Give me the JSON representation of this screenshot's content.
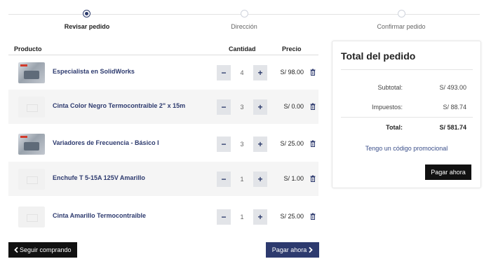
{
  "steps": [
    {
      "label": "Revisar pedido",
      "active": true
    },
    {
      "label": "Dirección",
      "active": false
    },
    {
      "label": "Confirmar pedido",
      "active": false
    }
  ],
  "table": {
    "headers": {
      "product": "Producto",
      "quantity": "Cantidad",
      "price": "Precio"
    },
    "rows": [
      {
        "name": "Especialista en SolidWorks",
        "qty": "4",
        "price": "S/ 98.00",
        "thumbnail": "image"
      },
      {
        "name": "Cinta Color Negro Termocontraible 2\" x 15m",
        "qty": "3",
        "price": "S/ 0.00",
        "thumbnail": "placeholder"
      },
      {
        "name": "Variadores de Frecuencia - Básico I",
        "qty": "3",
        "price": "S/ 25.00",
        "thumbnail": "image"
      },
      {
        "name": "Enchufe T 5-15A 125V Amarillo",
        "qty": "1",
        "price": "S/ 1.00",
        "thumbnail": "placeholder"
      },
      {
        "name": "Cinta Amarillo Termocontraible",
        "qty": "1",
        "price": "S/ 25.00",
        "thumbnail": "placeholder"
      }
    ],
    "minus_symbol": "−",
    "plus_symbol": "+"
  },
  "actions": {
    "continue_label": "Seguir comprando",
    "continue_icon": "chevron-left-icon",
    "pay_label": "Pagar ahora",
    "pay_icon": "chevron-right-icon"
  },
  "summary": {
    "title": "Total del pedido",
    "subtotal_label": "Subtotal:",
    "subtotal_value": "S/ 493.00",
    "tax_label": "Impuestos:",
    "tax_value": "S/ 88.74",
    "total_label": "Total:",
    "total_value": "S/ 581.74",
    "promo_label": "Tengo un código promocional",
    "pay_label": "Pagar ahora"
  },
  "colors": {
    "accent": "#2d3a6e",
    "dark_button": "#111111",
    "row_alt": "#f5f5f5"
  }
}
